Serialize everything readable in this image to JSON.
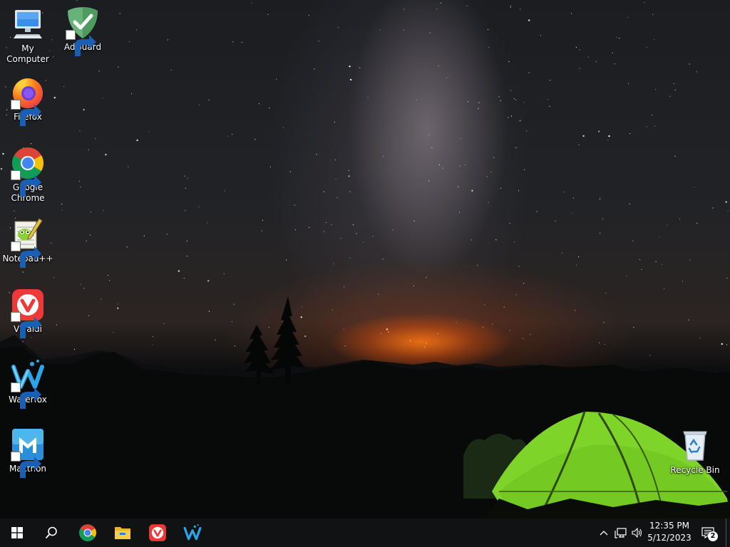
{
  "desktop": {
    "icons": [
      {
        "id": "my-computer",
        "label": "My Computer",
        "icon": "computer-icon",
        "shortcut": false
      },
      {
        "id": "adguard",
        "label": "AdGuard",
        "icon": "adguard-icon",
        "shortcut": true
      },
      {
        "id": "firefox",
        "label": "Firefox",
        "icon": "firefox-icon",
        "shortcut": true
      },
      {
        "id": "google-chrome",
        "label": "Google Chrome",
        "icon": "chrome-icon",
        "shortcut": true
      },
      {
        "id": "notepadpp",
        "label": "Notepad++",
        "icon": "notepadpp-icon",
        "shortcut": true
      },
      {
        "id": "vivaldi",
        "label": "Vivaldi",
        "icon": "vivaldi-icon",
        "shortcut": true
      },
      {
        "id": "waterfox",
        "label": "Waterfox",
        "icon": "waterfox-icon",
        "shortcut": true
      },
      {
        "id": "maxthon",
        "label": "Maxthon",
        "icon": "maxthon-icon",
        "shortcut": true
      },
      {
        "id": "recycle-bin",
        "label": "Recycle Bin",
        "icon": "recycle-bin-icon",
        "shortcut": false
      }
    ]
  },
  "taskbar": {
    "start": "windows-start-icon",
    "search": "search-icon",
    "pinned": [
      {
        "name": "Google Chrome",
        "icon": "chrome-icon"
      },
      {
        "name": "File Explorer",
        "icon": "folder-icon"
      },
      {
        "name": "Vivaldi",
        "icon": "vivaldi-icon"
      },
      {
        "name": "Waterfox",
        "icon": "waterfox-icon"
      }
    ],
    "tray": {
      "overflow": "chevron-up-icon",
      "network": "network-icon",
      "volume": "volume-icon",
      "time": "12:35 PM",
      "date": "5/12/2023",
      "notifications_count": "2"
    }
  },
  "colors": {
    "taskbar_bg": "#101214",
    "chrome_red": "#db4437",
    "chrome_yellow": "#f4c20d",
    "chrome_green": "#0f9d58",
    "chrome_blue": "#4285f4",
    "vivaldi_red": "#ef3939",
    "adguard_green": "#67b279",
    "tent_green": "#7fd42a"
  }
}
